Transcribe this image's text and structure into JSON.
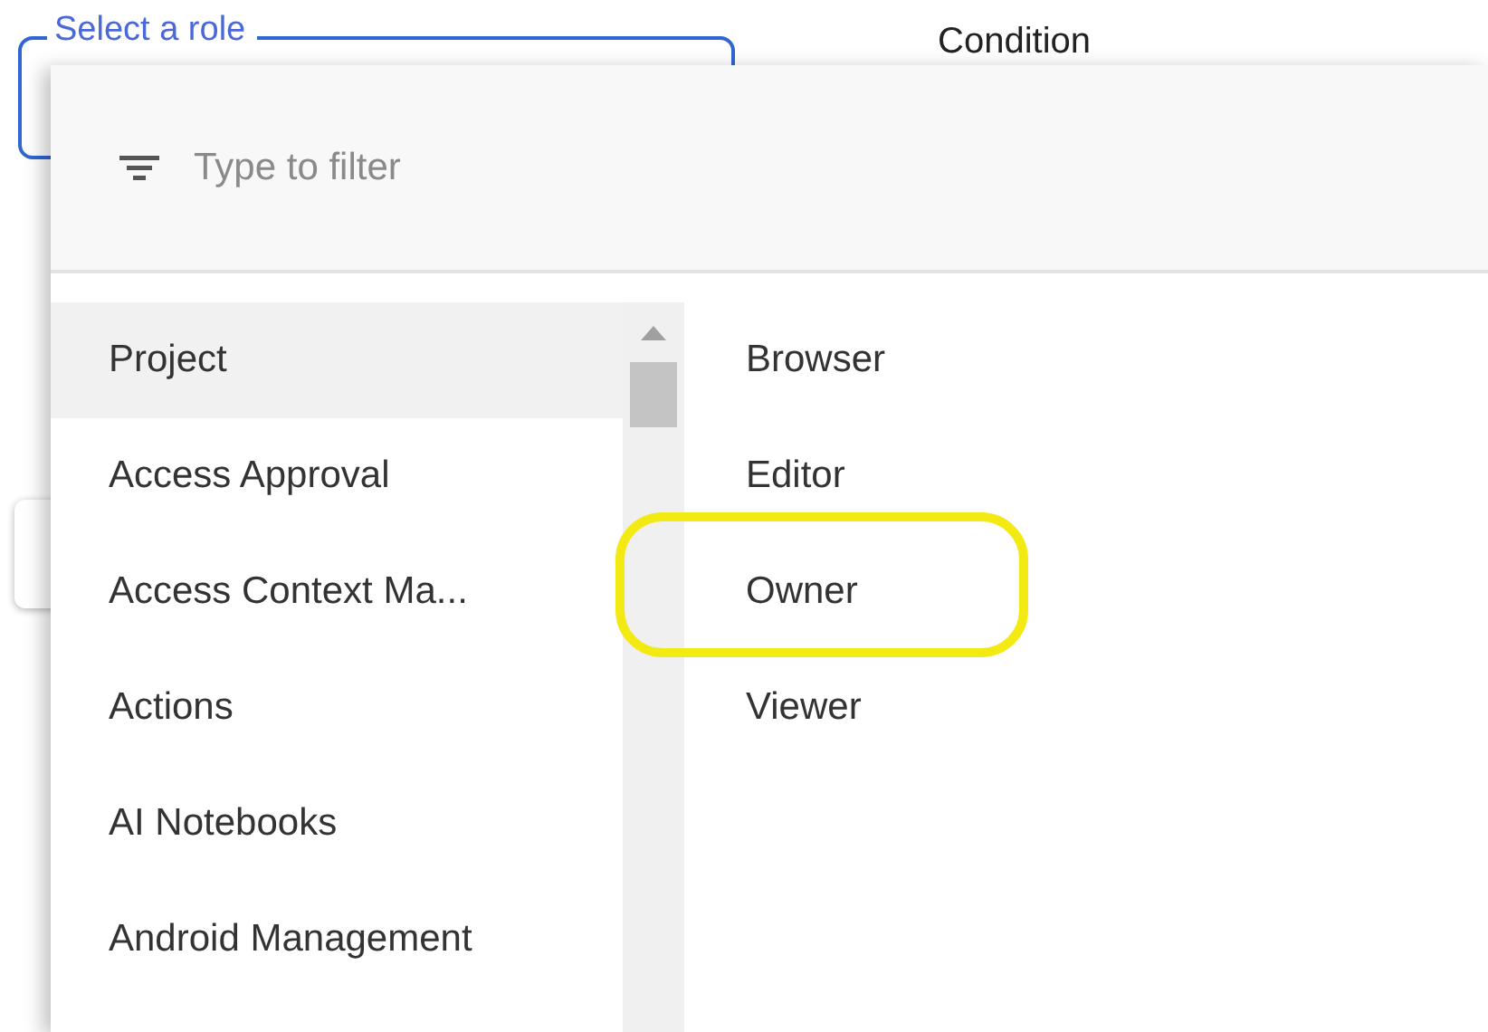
{
  "role_field": {
    "label": "Select a role"
  },
  "condition": {
    "label": "Condition"
  },
  "role_menu": {
    "filter": {
      "placeholder": "Type to filter"
    },
    "categories": [
      {
        "label": "Project",
        "selected": true
      },
      {
        "label": "Access Approval",
        "selected": false
      },
      {
        "label": "Access Context Ma...",
        "selected": false
      },
      {
        "label": "Actions",
        "selected": false
      },
      {
        "label": "AI Notebooks",
        "selected": false
      },
      {
        "label": "Android Management",
        "selected": false
      }
    ],
    "roles": [
      {
        "label": "Browser",
        "highlighted": false
      },
      {
        "label": "Editor",
        "highlighted": false
      },
      {
        "label": "Owner",
        "highlighted": true
      },
      {
        "label": "Viewer",
        "highlighted": false
      }
    ]
  }
}
